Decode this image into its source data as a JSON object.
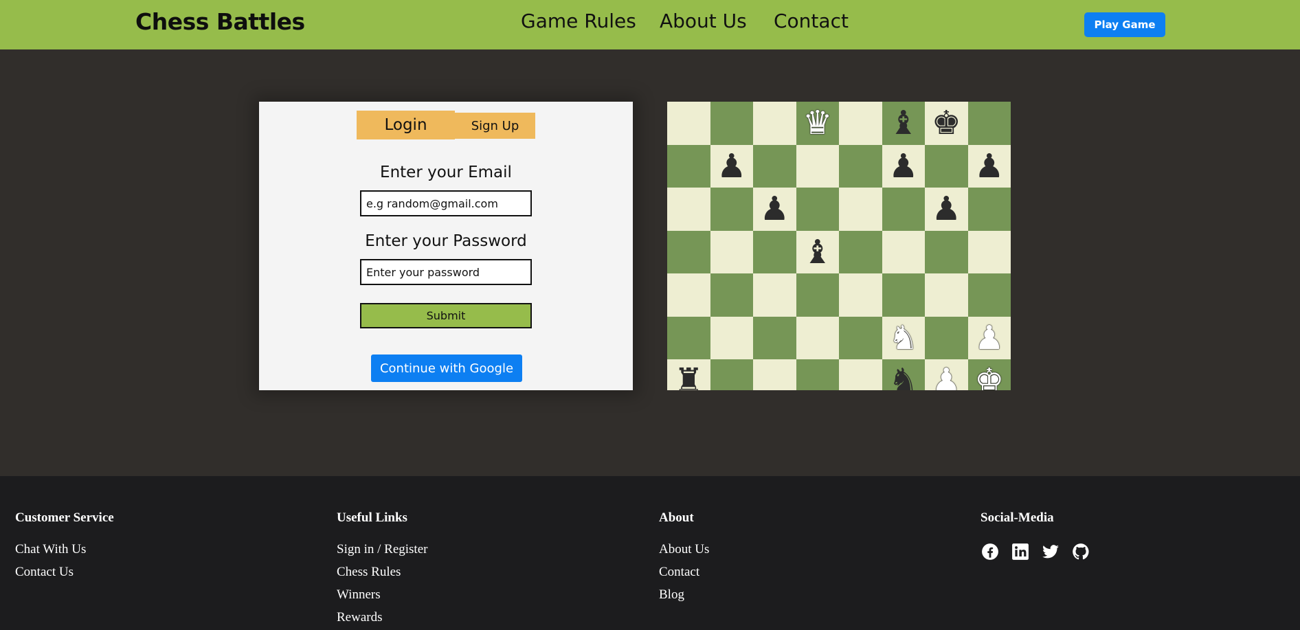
{
  "header": {
    "brand": "Chess Battles",
    "nav": [
      "Game Rules",
      "About Us",
      "Contact"
    ],
    "play_button": "Play Game"
  },
  "auth": {
    "tabs": [
      "Login",
      "Sign Up"
    ],
    "email_label": "Enter your Email",
    "email_placeholder": "e.g random@gmail.com",
    "password_label": "Enter your Password",
    "password_placeholder": "Enter your password",
    "submit": "Submit",
    "google": "Continue with Google"
  },
  "board": {
    "rows": [
      [
        "",
        "",
        "",
        "wQ",
        "",
        "bB",
        "bK",
        ""
      ],
      [
        "",
        "bP",
        "",
        "",
        "",
        "bP",
        "",
        "bP"
      ],
      [
        "",
        "",
        "bP",
        "",
        "",
        "",
        "bP",
        ""
      ],
      [
        "",
        "",
        "",
        "bB",
        "",
        "",
        "",
        ""
      ],
      [
        "",
        "",
        "",
        "",
        "",
        "",
        "",
        ""
      ],
      [
        "",
        "",
        "",
        "",
        "",
        "wN",
        "",
        "wP"
      ],
      [
        "bR",
        "",
        "",
        "",
        "",
        "bN",
        "wP",
        "wK"
      ]
    ]
  },
  "footer": {
    "columns": [
      {
        "title": "Customer Service",
        "links": [
          "Chat With Us",
          "Contact Us"
        ]
      },
      {
        "title": "Useful Links",
        "links": [
          "Sign in / Register",
          "Chess Rules",
          "Winners",
          "Rewards"
        ]
      },
      {
        "title": "About",
        "links": [
          "About Us",
          "Contact",
          "Blog"
        ]
      }
    ],
    "social_title": "Social-Media",
    "social_icons": [
      "facebook-icon",
      "linkedin-icon",
      "twitter-icon",
      "github-icon"
    ]
  }
}
